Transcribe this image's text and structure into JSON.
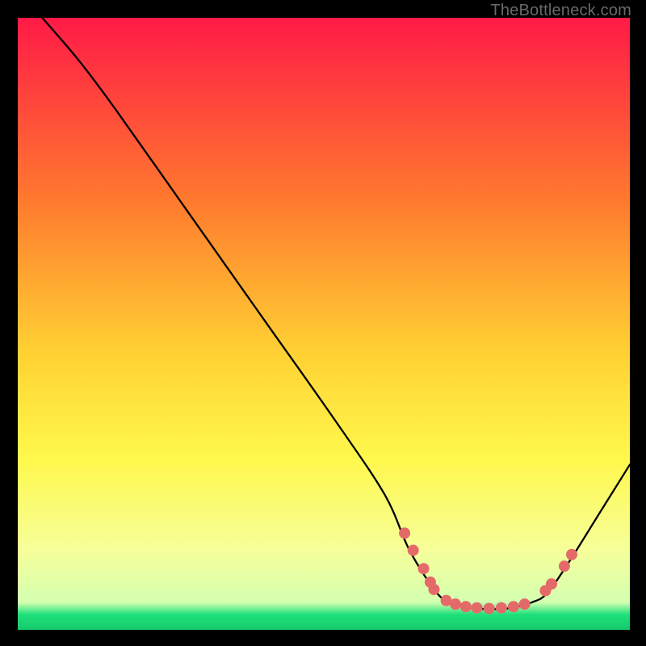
{
  "attribution": "TheBottleneck.com",
  "colors": {
    "bg_black": "#000000",
    "grad_top": "#ff1a47",
    "grad_mid1": "#ff7a2e",
    "grad_mid2": "#ffd233",
    "grad_mid3": "#fff84c",
    "grad_bottom_y": "#f6ff9a",
    "grad_green": "#1ee07a",
    "curve": "#000000",
    "markers": "#e46a6a",
    "attribution": "#69686b"
  },
  "chart_data": {
    "type": "line",
    "title": "",
    "xlabel": "",
    "ylabel": "",
    "xlim": [
      0,
      100
    ],
    "ylim": [
      0,
      100
    ],
    "grid": false,
    "legend": false,
    "series": [
      {
        "name": "curve",
        "points": [
          {
            "x": 4,
            "y": 100
          },
          {
            "x": 10,
            "y": 93
          },
          {
            "x": 16,
            "y": 85
          },
          {
            "x": 28,
            "y": 68
          },
          {
            "x": 40,
            "y": 51
          },
          {
            "x": 52,
            "y": 34
          },
          {
            "x": 60,
            "y": 22
          },
          {
            "x": 64,
            "y": 13
          },
          {
            "x": 68.5,
            "y": 6
          },
          {
            "x": 71,
            "y": 4.5
          },
          {
            "x": 75,
            "y": 3.5
          },
          {
            "x": 80,
            "y": 3.5
          },
          {
            "x": 84,
            "y": 4.5
          },
          {
            "x": 86.5,
            "y": 6
          },
          {
            "x": 90,
            "y": 11
          },
          {
            "x": 95,
            "y": 19
          },
          {
            "x": 100,
            "y": 27
          }
        ]
      }
    ],
    "markers": [
      {
        "x": 63.2,
        "y": 15.8
      },
      {
        "x": 64.6,
        "y": 13.0
      },
      {
        "x": 66.3,
        "y": 10.0
      },
      {
        "x": 67.4,
        "y": 7.8
      },
      {
        "x": 68.0,
        "y": 6.6
      },
      {
        "x": 70.0,
        "y": 4.8
      },
      {
        "x": 71.5,
        "y": 4.2
      },
      {
        "x": 73.2,
        "y": 3.8
      },
      {
        "x": 75.0,
        "y": 3.6
      },
      {
        "x": 77.0,
        "y": 3.5
      },
      {
        "x": 79.0,
        "y": 3.6
      },
      {
        "x": 81.0,
        "y": 3.8
      },
      {
        "x": 82.8,
        "y": 4.2
      },
      {
        "x": 86.2,
        "y": 6.4
      },
      {
        "x": 87.2,
        "y": 7.5
      },
      {
        "x": 89.3,
        "y": 10.4
      },
      {
        "x": 90.5,
        "y": 12.3
      }
    ],
    "marker_radius_px": 7.0
  }
}
